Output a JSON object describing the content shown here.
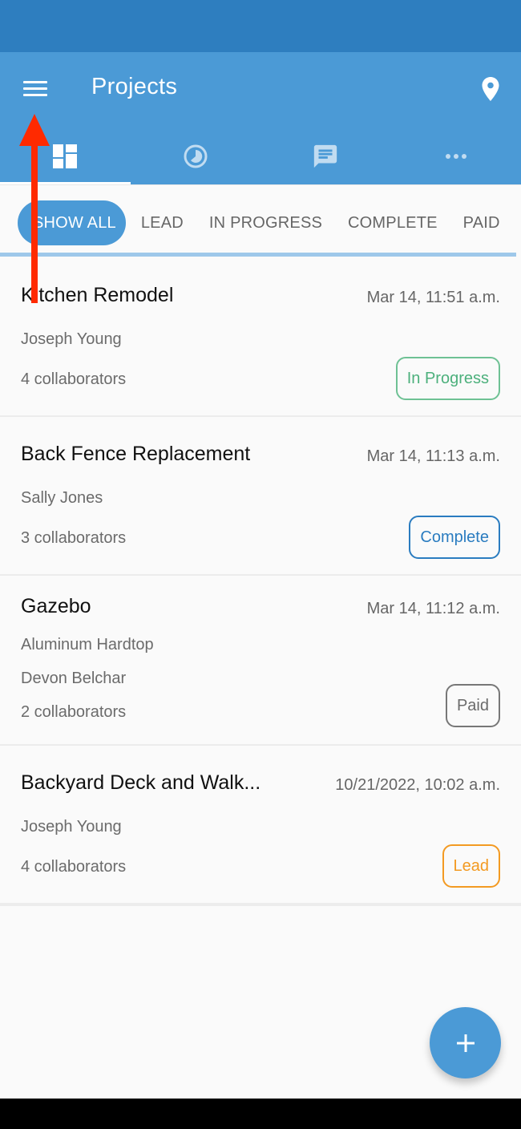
{
  "app_bar": {
    "title": "Projects",
    "menu_icon": "hamburger-menu-icon",
    "location_icon": "map-pin-icon",
    "background_color": "#4b9ad6",
    "status_bar_color": "#2e7ebf"
  },
  "tabs": [
    {
      "icon": "dashboard-icon",
      "active": true
    },
    {
      "icon": "clock-icon",
      "active": false
    },
    {
      "icon": "chat-message-icon",
      "active": false
    },
    {
      "icon": "more-horizontal-icon",
      "active": false
    }
  ],
  "filters": {
    "items": [
      "SHOW ALL",
      "LEAD",
      "IN PROGRESS",
      "COMPLETE",
      "PAID"
    ],
    "selected": "SHOW ALL"
  },
  "projects": [
    {
      "title": "Kitchen Remodel",
      "date": "Mar 14, 11:51 a.m.",
      "subtitle": "",
      "client": "Joseph Young",
      "collaborators": "4 collaborators",
      "status": "In Progress",
      "status_color": "#4cb07c"
    },
    {
      "title": "Back Fence Replacement",
      "date": "Mar 14, 11:13 a.m.",
      "subtitle": "",
      "client": "Sally Jones",
      "collaborators": "3 collaborators",
      "status": "Complete",
      "status_color": "#2a7cc0"
    },
    {
      "title": "Gazebo",
      "date": "Mar 14, 11:12 a.m.",
      "subtitle": "Aluminum Hardtop",
      "client": "Devon Belchar",
      "collaborators": "2 collaborators",
      "status": "Paid",
      "status_color": "#6b6b6b"
    },
    {
      "title": "Backyard Deck and Walk...",
      "date": "10/21/2022, 10:02 a.m.",
      "subtitle": "",
      "client": "Joseph Young",
      "collaborators": "4 collaborators",
      "status": "Lead",
      "status_color": "#f39a22"
    }
  ],
  "fab": {
    "icon": "plus-icon"
  },
  "annotation": {
    "icon": "red-arrow-up-icon",
    "color": "#ff2a00"
  }
}
